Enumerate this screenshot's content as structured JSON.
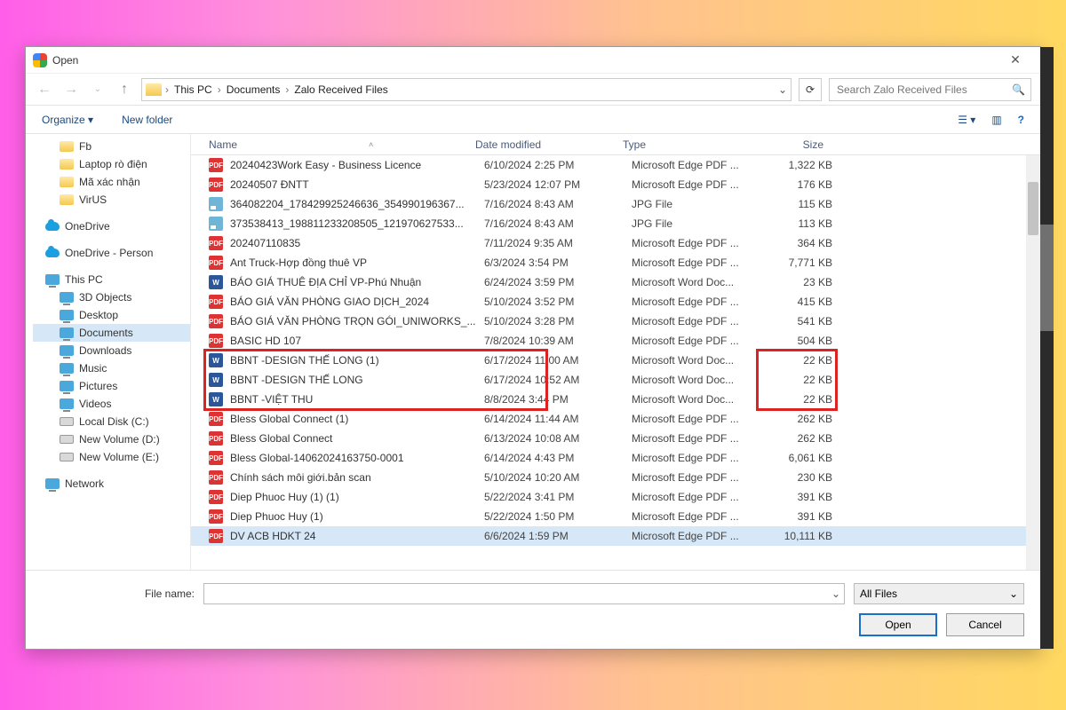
{
  "window": {
    "title": "Open"
  },
  "breadcrumb": [
    "This PC",
    "Documents",
    "Zalo Received Files"
  ],
  "search": {
    "placeholder": "Search Zalo Received Files"
  },
  "toolbar": {
    "organize": "Organize",
    "newfolder": "New folder"
  },
  "tree": {
    "quick": [
      {
        "label": "Fb",
        "icon": "folder"
      },
      {
        "label": "Laptop rò điện",
        "icon": "folder"
      },
      {
        "label": "Mã xác nhận",
        "icon": "folder"
      },
      {
        "label": "VirUS",
        "icon": "folder"
      }
    ],
    "clouds": [
      {
        "label": "OneDrive",
        "icon": "cloud"
      },
      {
        "label": "OneDrive - Person",
        "icon": "cloud"
      }
    ],
    "pc": {
      "label": "This PC"
    },
    "pcitems": [
      {
        "label": "3D Objects",
        "icon": "pc"
      },
      {
        "label": "Desktop",
        "icon": "pc"
      },
      {
        "label": "Documents",
        "icon": "pc",
        "selected": true
      },
      {
        "label": "Downloads",
        "icon": "pc"
      },
      {
        "label": "Music",
        "icon": "pc"
      },
      {
        "label": "Pictures",
        "icon": "pc"
      },
      {
        "label": "Videos",
        "icon": "pc"
      },
      {
        "label": "Local Disk (C:)",
        "icon": "drive"
      },
      {
        "label": "New Volume (D:)",
        "icon": "drive"
      },
      {
        "label": "New Volume (E:)",
        "icon": "drive"
      }
    ],
    "network": {
      "label": "Network"
    }
  },
  "columns": {
    "name": "Name",
    "date": "Date modified",
    "type": "Type",
    "size": "Size"
  },
  "files": [
    {
      "icon": "pdf",
      "name": "20240423Work Easy - Business Licence",
      "date": "6/10/2024 2:25 PM",
      "type": "Microsoft Edge PDF ...",
      "size": "1,322 KB"
    },
    {
      "icon": "pdf",
      "name": "20240507 ĐNTT",
      "date": "5/23/2024 12:07 PM",
      "type": "Microsoft Edge PDF ...",
      "size": "176 KB"
    },
    {
      "icon": "jpg",
      "name": "364082204_178429925246636_354990196367...",
      "date": "7/16/2024 8:43 AM",
      "type": "JPG File",
      "size": "115 KB"
    },
    {
      "icon": "jpg",
      "name": "373538413_198811233208505_121970627533...",
      "date": "7/16/2024 8:43 AM",
      "type": "JPG File",
      "size": "113 KB"
    },
    {
      "icon": "pdf",
      "name": "202407110835",
      "date": "7/11/2024 9:35 AM",
      "type": "Microsoft Edge PDF ...",
      "size": "364 KB"
    },
    {
      "icon": "pdf",
      "name": "Ant Truck-Hợp đồng thuê VP",
      "date": "6/3/2024 3:54 PM",
      "type": "Microsoft Edge PDF ...",
      "size": "7,771 KB"
    },
    {
      "icon": "word",
      "name": "BÁO GIÁ THUÊ ĐỊA CHỈ VP-Phú Nhuận",
      "date": "6/24/2024 3:59 PM",
      "type": "Microsoft Word Doc...",
      "size": "23 KB"
    },
    {
      "icon": "pdf",
      "name": "BÁO GIÁ VĂN PHÒNG GIAO DỊCH_2024",
      "date": "5/10/2024 3:52 PM",
      "type": "Microsoft Edge PDF ...",
      "size": "415 KB"
    },
    {
      "icon": "pdf",
      "name": "BÁO GIÁ VĂN PHÒNG TRỌN GÓI_UNIWORKS_...",
      "date": "5/10/2024 3:28 PM",
      "type": "Microsoft Edge PDF ...",
      "size": "541 KB"
    },
    {
      "icon": "pdf",
      "name": "BASIC HD 107",
      "date": "7/8/2024 10:39 AM",
      "type": "Microsoft Edge PDF ...",
      "size": "504 KB"
    },
    {
      "icon": "word",
      "name": "BBNT -DESIGN THẾ LONG (1)",
      "date": "6/17/2024 11:00 AM",
      "type": "Microsoft Word Doc...",
      "size": "22 KB",
      "hl": true
    },
    {
      "icon": "word",
      "name": "BBNT -DESIGN THẾ LONG",
      "date": "6/17/2024 10:52 AM",
      "type": "Microsoft Word Doc...",
      "size": "22 KB",
      "hl": true
    },
    {
      "icon": "word",
      "name": "BBNT -VIỆT THU",
      "date": "8/8/2024 3:44 PM",
      "type": "Microsoft Word Doc...",
      "size": "22 KB",
      "hl": true
    },
    {
      "icon": "pdf",
      "name": "Bless Global Connect (1)",
      "date": "6/14/2024 11:44 AM",
      "type": "Microsoft Edge PDF ...",
      "size": "262 KB"
    },
    {
      "icon": "pdf",
      "name": "Bless Global Connect",
      "date": "6/13/2024 10:08 AM",
      "type": "Microsoft Edge PDF ...",
      "size": "262 KB"
    },
    {
      "icon": "pdf",
      "name": "Bless Global-14062024163750-0001",
      "date": "6/14/2024 4:43 PM",
      "type": "Microsoft Edge PDF ...",
      "size": "6,061 KB"
    },
    {
      "icon": "pdf",
      "name": "Chính sách môi giới.bản scan",
      "date": "5/10/2024 10:20 AM",
      "type": "Microsoft Edge PDF ...",
      "size": "230 KB"
    },
    {
      "icon": "pdf",
      "name": "Diep Phuoc Huy (1) (1)",
      "date": "5/22/2024 3:41 PM",
      "type": "Microsoft Edge PDF ...",
      "size": "391 KB"
    },
    {
      "icon": "pdf",
      "name": "Diep Phuoc Huy (1)",
      "date": "5/22/2024 1:50 PM",
      "type": "Microsoft Edge PDF ...",
      "size": "391 KB"
    },
    {
      "icon": "pdf",
      "name": "DV ACB HDKT 24",
      "date": "6/6/2024 1:59 PM",
      "type": "Microsoft Edge PDF ...",
      "size": "10,111 KB",
      "sel": true
    }
  ],
  "bottom": {
    "filename_label": "File name:",
    "filter": "All Files",
    "open": "Open",
    "cancel": "Cancel"
  }
}
